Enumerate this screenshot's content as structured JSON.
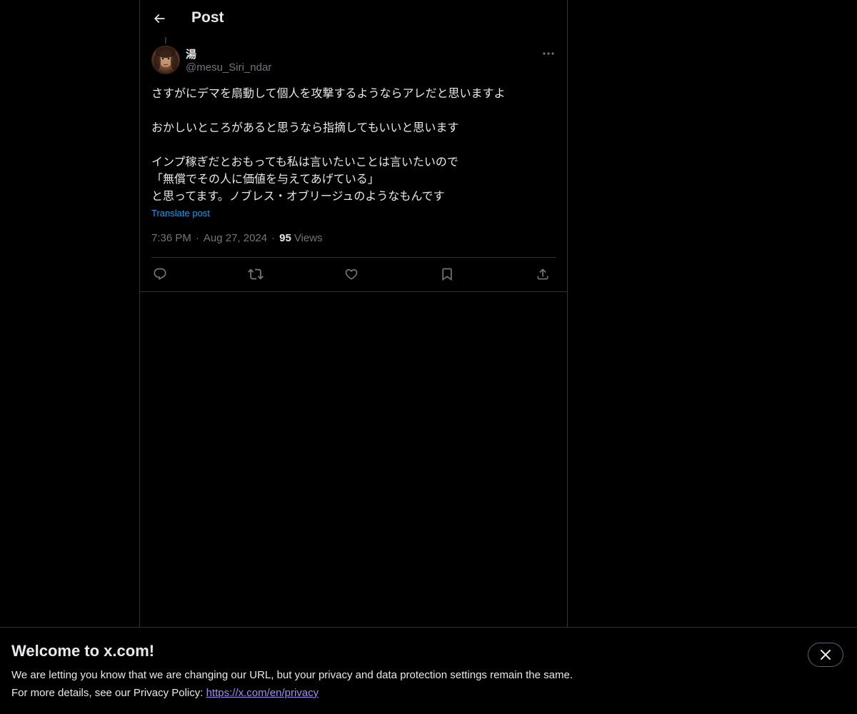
{
  "header": {
    "back_icon": "arrow-left-icon",
    "title": "Post"
  },
  "post": {
    "author": {
      "display_name": "湯",
      "handle": "@mesu_Siri_ndar"
    },
    "text": "さすがにデマを扇動して個人を攻撃するようならアレだと思いますよ\n\nおかしいところがあると思うなら指摘してもいいと思います\n\nインプ稼ぎだとおもっても私は言いたいことは言いたいので\n「無償でその人に価値を与えてあげている」\nと思ってます。ノブレス・オブリージュのようなもんです",
    "translate_label": "Translate post",
    "time": "7:36 PM",
    "date": "Aug 27, 2024",
    "separator": "·",
    "views_count": "95",
    "views_label": "Views",
    "actions": [
      "reply-icon",
      "repost-icon",
      "like-icon",
      "bookmark-icon",
      "share-icon"
    ]
  },
  "banner": {
    "title": "Welcome to x.com!",
    "line1": "We are letting you know that we are changing our URL, but your privacy and data protection settings remain the same.",
    "line2_prefix": "For more details, see our Privacy Policy: ",
    "link": "https://x.com/en/privacy",
    "close_icon": "close-icon"
  },
  "colors": {
    "background": "#000000",
    "text": "#e7e9ea",
    "muted": "#71767b",
    "accent": "#1d9bf0",
    "border": "#2f3336",
    "link": "#a08cf0"
  }
}
